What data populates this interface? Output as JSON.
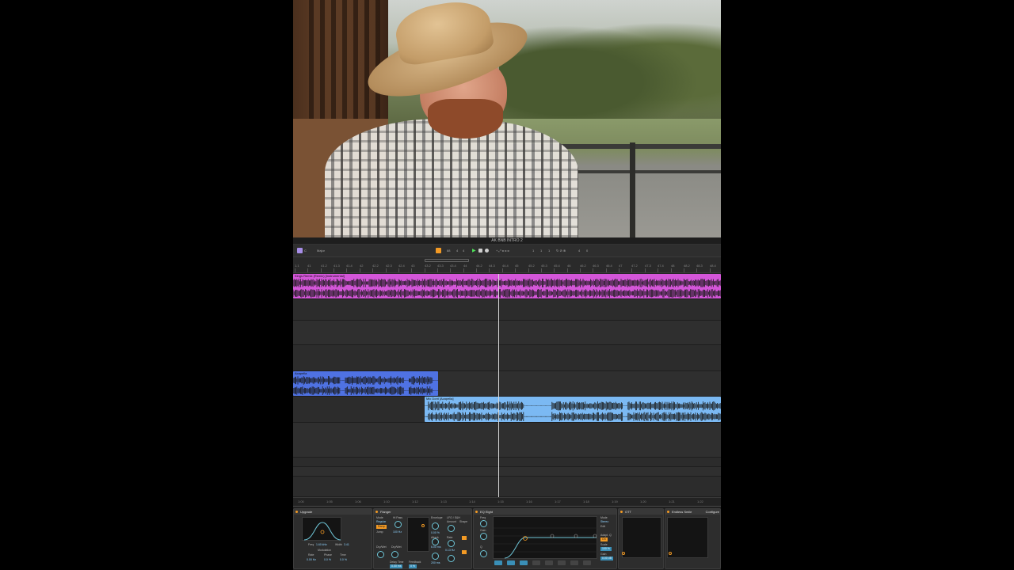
{
  "window": {
    "title": "AK BNB INTRO 2"
  },
  "toolbar": {
    "key": "C",
    "scale": "Major",
    "tempo": "88",
    "signature_num": "4",
    "signature_den": "4",
    "bar": "1",
    "beat": "1",
    "sixteenth": "1",
    "loop_start": "4",
    "loop_end": "0"
  },
  "ruler": {
    "ticks": [
      "1.1",
      "41",
      "41.2",
      "41.3",
      "41.4",
      "42",
      "42.2",
      "42.3",
      "42.4",
      "43",
      "43.2",
      "43.3",
      "43.4",
      "44",
      "44.2",
      "44.3",
      "44.4",
      "45",
      "45.2",
      "45.3",
      "45.4",
      "46",
      "46.2",
      "46.3",
      "46.4",
      "47",
      "47.2",
      "47.3",
      "47.4",
      "48",
      "48.2",
      "48.3",
      "48.4"
    ]
  },
  "tracks": {
    "instrumental_clip": "Kings Remix (Remix) [Instrumental]",
    "acapella1_clip": "Acapella",
    "acapella2_clip": "Mic Dont [Acapella]"
  },
  "timeline2": {
    "ticks": [
      "1:00",
      "1:05",
      "1:06",
      "1:10",
      "1:12",
      "1:13",
      "1:14",
      "1:15",
      "1:16",
      "1:17",
      "1:18",
      "1:19",
      "1:20",
      "1:21",
      "1:22"
    ]
  },
  "devices": {
    "device1": {
      "title": "Upgrade",
      "freq_label": "Freq",
      "freq_value": "1.60 kHz",
      "width_label": "Width",
      "width_value": "3.41",
      "rate_label": "Rate",
      "rate_value": "0.00 Hz",
      "phase_label": "Phase",
      "phase_value": "0.0 %",
      "time_label": "Time",
      "time_value": "0.0 %",
      "modulation_label": "Modulation"
    },
    "flanger": {
      "title": "Flanger",
      "mode_label": "Mode",
      "mode_value": "Regular",
      "mode_btn": "Ramp",
      "jump_label": "Jump",
      "hi_pass_label": "Hi Pass",
      "hi_pass_value": "100 Hz",
      "envelope_label": "Envelope",
      "lfo_label": "LFO / S&H",
      "amount_label": "Amount",
      "shape_label": "Shape",
      "attack_label": "Attack",
      "rate_label": "Rate",
      "rate_value": "0.13 Hz",
      "dry_wet_label": "Dry/Wet",
      "delay_label": "Delay Time",
      "feedback_label": "Feedback",
      "env_value": "0.00 %",
      "attack_value": "6.00 ms",
      "release_value": "200 ms"
    },
    "eq": {
      "title": "EQ Eight",
      "freq_label": "Freq",
      "gain_label": "Gain",
      "q_label": "Q",
      "mode_label": "Mode",
      "mode_value": "Stereo",
      "edit_label": "Edit",
      "adapt_label": "Adapt. Q",
      "adapt_value": "On",
      "scale_label": "Scale",
      "scale_value": "100 %",
      "gain_out_label": "Gain",
      "gain_out_value": "0.00 dB"
    },
    "ott": {
      "title": "OTT"
    },
    "bus": {
      "title": "Endless Smile",
      "config_label": "Configure"
    }
  },
  "colors": {
    "instrumental": "#d456d9",
    "acapella1": "#4f72e3",
    "acapella2": "#7bb9f3",
    "accent": "#f39a24",
    "knob": "#6fc6d8"
  }
}
